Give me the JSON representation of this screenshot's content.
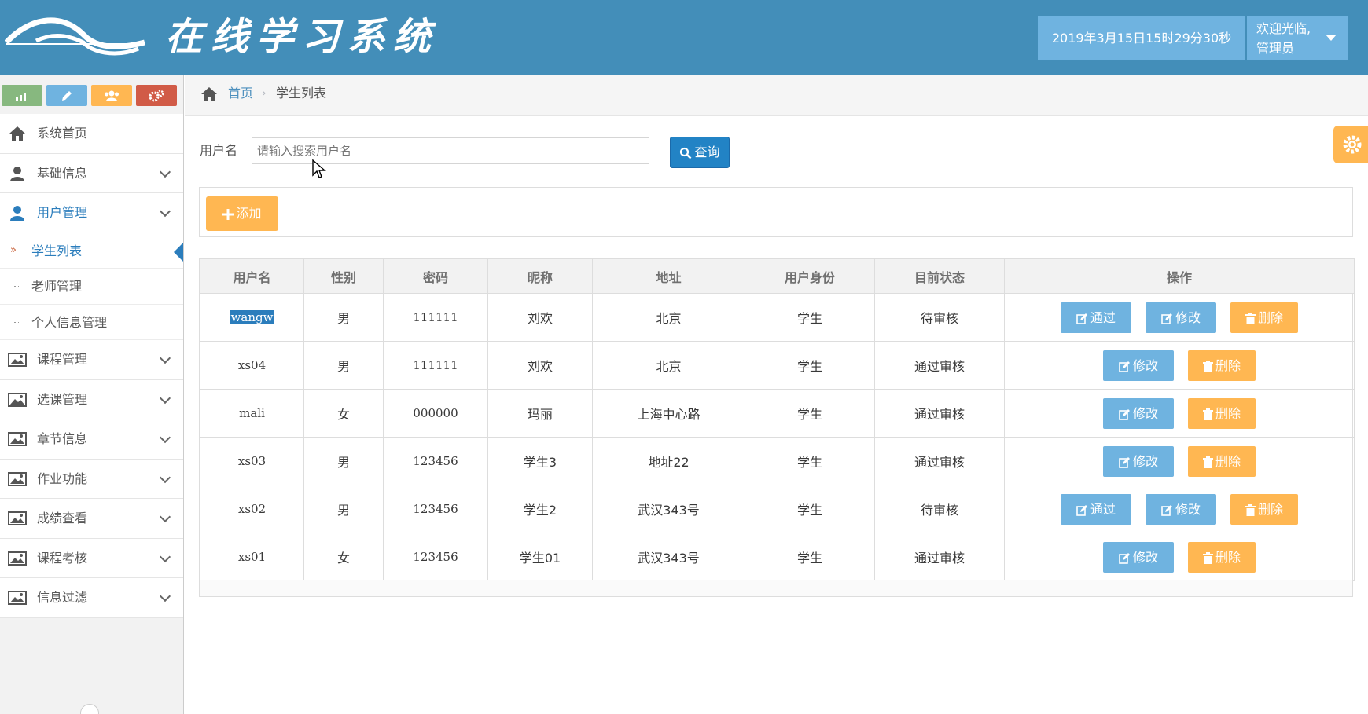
{
  "header": {
    "brand": "在线学习系统",
    "datetime": "2019年3月15日15时29分30秒",
    "welcome": "欢迎光临,",
    "role": "管理员"
  },
  "sidebar": {
    "shortcuts": [
      "stats-icon",
      "pencil-icon",
      "users-icon",
      "cogs-icon"
    ],
    "items": [
      {
        "label": "系统首页",
        "icon": "home-icon"
      },
      {
        "label": "基础信息",
        "icon": "user-icon"
      },
      {
        "label": "用户管理",
        "icon": "user-icon"
      },
      {
        "label": "课程管理",
        "icon": "picture-icon"
      },
      {
        "label": "选课管理",
        "icon": "picture-icon"
      },
      {
        "label": "章节信息",
        "icon": "picture-icon"
      },
      {
        "label": "作业功能",
        "icon": "picture-icon"
      },
      {
        "label": "成绩查看",
        "icon": "picture-icon"
      },
      {
        "label": "课程考核",
        "icon": "picture-icon"
      },
      {
        "label": "信息过滤",
        "icon": "picture-icon"
      }
    ],
    "subitems": [
      {
        "label": "学生列表"
      },
      {
        "label": "老师管理"
      },
      {
        "label": "个人信息管理"
      }
    ]
  },
  "breadcrumb": {
    "home": "首页",
    "current": "学生列表"
  },
  "search": {
    "label": "用户名",
    "placeholder": "请输入搜索用户名",
    "button": "查询"
  },
  "toolbar": {
    "add_label": "添加"
  },
  "table": {
    "headers": [
      "用户名",
      "性别",
      "密码",
      "昵称",
      "地址",
      "用户身份",
      "目前状态",
      "操作"
    ],
    "rows": [
      {
        "username": "wangw",
        "gender": "男",
        "password": "111111",
        "nickname": "刘欢",
        "address": "北京",
        "role": "学生",
        "status": "待审核"
      },
      {
        "username": "xs04",
        "gender": "男",
        "password": "111111",
        "nickname": "刘欢",
        "address": "北京",
        "role": "学生",
        "status": "通过审核"
      },
      {
        "username": "mali",
        "gender": "女",
        "password": "000000",
        "nickname": "玛丽",
        "address": "上海中心路",
        "role": "学生",
        "status": "通过审核"
      },
      {
        "username": "xs03",
        "gender": "男",
        "password": "123456",
        "nickname": "学生3",
        "address": "地址22",
        "role": "学生",
        "status": "通过审核"
      },
      {
        "username": "xs02",
        "gender": "男",
        "password": "123456",
        "nickname": "学生2",
        "address": "武汉343号",
        "role": "学生",
        "status": "待审核"
      },
      {
        "username": "xs01",
        "gender": "女",
        "password": "123456",
        "nickname": "学生01",
        "address": "武汉343号",
        "role": "学生",
        "status": "通过审核"
      }
    ],
    "actions": {
      "approve": "通过",
      "edit": "修改",
      "delete": "删除"
    }
  },
  "colors": {
    "header": "#438eb9",
    "accent_blue": "#6fb3e0",
    "accent_orange": "#ffb752",
    "primary": "#2283c5"
  }
}
